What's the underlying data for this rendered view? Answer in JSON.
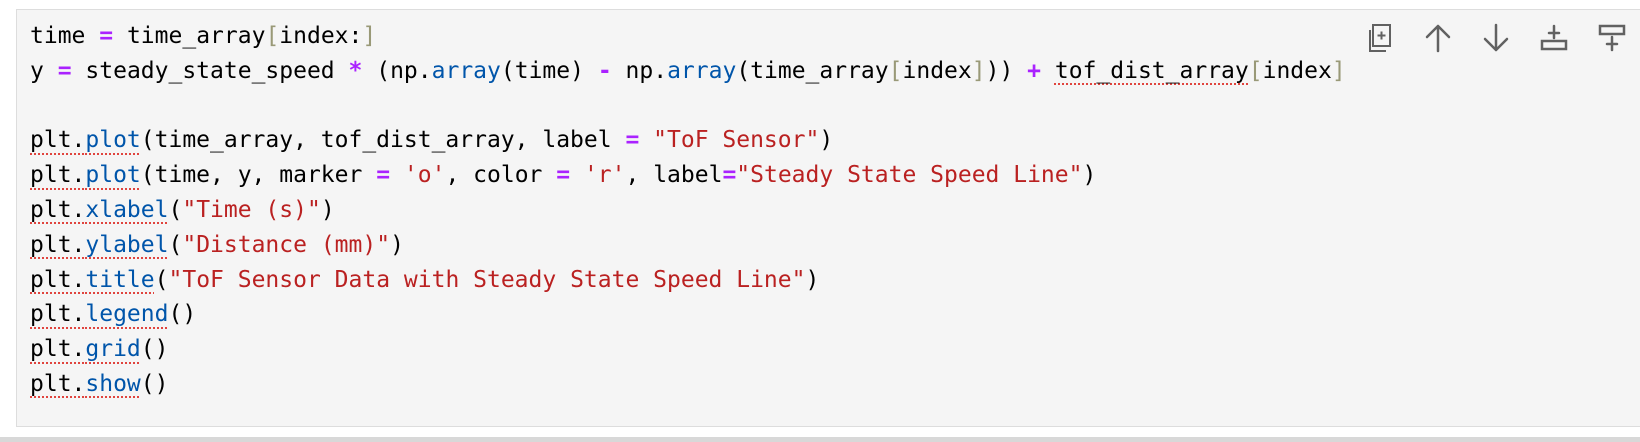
{
  "cell": {
    "lines": [
      [
        {
          "t": "time "
        },
        {
          "t": "=",
          "c": "op"
        },
        {
          "t": " time_array"
        },
        {
          "t": "[",
          "c": "brk"
        },
        {
          "t": "index:"
        },
        {
          "t": "]",
          "c": "brk"
        }
      ],
      [
        {
          "t": "y "
        },
        {
          "t": "=",
          "c": "op"
        },
        {
          "t": " steady_state_speed "
        },
        {
          "t": "*",
          "c": "op"
        },
        {
          "t": " (np."
        },
        {
          "t": "array",
          "c": "fn"
        },
        {
          "t": "(time) "
        },
        {
          "t": "-",
          "c": "op"
        },
        {
          "t": " np."
        },
        {
          "t": "array",
          "c": "fn"
        },
        {
          "t": "(time_array"
        },
        {
          "t": "[",
          "c": "brk"
        },
        {
          "t": "index"
        },
        {
          "t": "]",
          "c": "brk"
        },
        {
          "t": ")) "
        },
        {
          "t": "+",
          "c": "op"
        },
        {
          "t": " "
        },
        {
          "t": "tof_dist_array",
          "c": "lint"
        },
        {
          "t": "[",
          "c": "brk"
        },
        {
          "t": "index"
        },
        {
          "t": "]",
          "c": "brk"
        }
      ],
      [],
      [
        {
          "t": "plt.",
          "c": "lint"
        },
        {
          "t": "plot",
          "c": "fn lint"
        },
        {
          "t": "(time_array, tof_dist_array, label "
        },
        {
          "t": "=",
          "c": "op"
        },
        {
          "t": " "
        },
        {
          "t": "\"ToF Sensor\"",
          "c": "str"
        },
        {
          "t": ")"
        }
      ],
      [
        {
          "t": "plt.",
          "c": "lint"
        },
        {
          "t": "plot",
          "c": "fn lint"
        },
        {
          "t": "(time, y, marker "
        },
        {
          "t": "=",
          "c": "op"
        },
        {
          "t": " "
        },
        {
          "t": "'o'",
          "c": "str"
        },
        {
          "t": ", color "
        },
        {
          "t": "=",
          "c": "op"
        },
        {
          "t": " "
        },
        {
          "t": "'r'",
          "c": "str"
        },
        {
          "t": ", label"
        },
        {
          "t": "=",
          "c": "op"
        },
        {
          "t": "\"Steady State Speed Line\"",
          "c": "str"
        },
        {
          "t": ")"
        }
      ],
      [
        {
          "t": "plt.",
          "c": "lint"
        },
        {
          "t": "xlabel",
          "c": "fn lint"
        },
        {
          "t": "("
        },
        {
          "t": "\"Time (s)\"",
          "c": "str"
        },
        {
          "t": ")"
        }
      ],
      [
        {
          "t": "plt.",
          "c": "lint"
        },
        {
          "t": "ylabel",
          "c": "fn lint"
        },
        {
          "t": "("
        },
        {
          "t": "\"Distance (mm)\"",
          "c": "str"
        },
        {
          "t": ")"
        }
      ],
      [
        {
          "t": "plt.",
          "c": "lint"
        },
        {
          "t": "title",
          "c": "fn lint"
        },
        {
          "t": "("
        },
        {
          "t": "\"ToF Sensor Data with Steady State Speed Line\"",
          "c": "str"
        },
        {
          "t": ")"
        }
      ],
      [
        {
          "t": "plt.",
          "c": "lint"
        },
        {
          "t": "legend",
          "c": "fn lint"
        },
        {
          "t": "()"
        }
      ],
      [
        {
          "t": "plt.",
          "c": "lint"
        },
        {
          "t": "grid",
          "c": "fn lint"
        },
        {
          "t": "()"
        }
      ],
      [
        {
          "t": "plt.",
          "c": "lint"
        },
        {
          "t": "show",
          "c": "fn lint"
        },
        {
          "t": "()"
        }
      ]
    ]
  },
  "toolbar": {
    "buttons": [
      {
        "name": "duplicate-cell-button",
        "icon": "copy-icon"
      },
      {
        "name": "move-up-button",
        "icon": "arrow-up-icon"
      },
      {
        "name": "move-down-button",
        "icon": "arrow-down-icon"
      },
      {
        "name": "insert-below-button",
        "icon": "insert-below-icon"
      },
      {
        "name": "insert-above-button",
        "icon": "insert-above-icon"
      }
    ]
  },
  "colors": {
    "cell_background": "#f5f5f5",
    "operator": "#aa22ff",
    "function": "#0055aa",
    "string": "#ba2121",
    "bracket": "#999977",
    "lint_underline": "#e0443e",
    "icon": "#616161"
  }
}
